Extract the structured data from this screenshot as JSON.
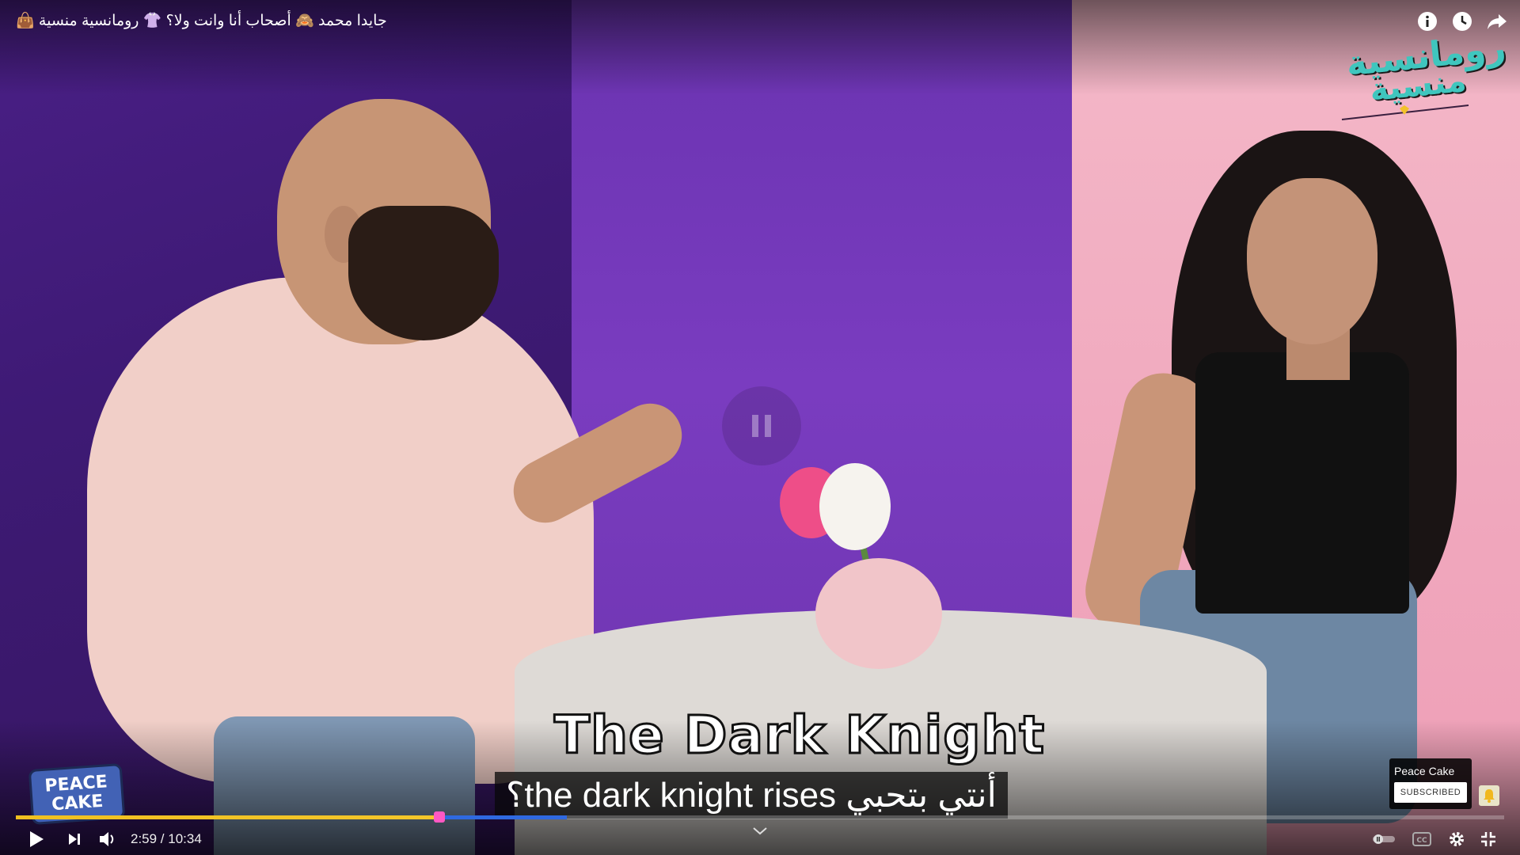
{
  "video": {
    "title": "جايدا محمد 🙈 أصحاب أنا وانت ولا؟ 👚 رومانسية منسية 👜",
    "show_logo_line1": "رومانسية",
    "show_logo_line2": "منسية"
  },
  "captions": {
    "main": "The Dark Knight",
    "subtitle": "أنتي بتحبي the dark knight rises؟"
  },
  "branding": {
    "watermark_line1": "PEACE",
    "watermark_line2": "CAKE"
  },
  "subscribe_card": {
    "channel_name": "Peace Cake",
    "button_label": "SUBSCRIBED"
  },
  "player": {
    "time_display": "2:59 / 10:34",
    "played_fraction": 0.283,
    "buffered_fraction": 0.37,
    "icons": {
      "info": "info-icon",
      "watch_later": "clock-icon",
      "share": "share-icon",
      "play": "play-icon",
      "next": "next-icon",
      "volume": "volume-icon",
      "autoplay": "autoplay-toggle-icon",
      "captions": "captions-icon",
      "settings": "gear-icon",
      "exit_fullscreen": "exit-fullscreen-icon",
      "chevron": "chevron-down-icon",
      "bell": "bell-icon",
      "pause_indicator": "pause-icon"
    },
    "colors": {
      "progress_played": "#f0c020",
      "scrubber": "#ff58c3"
    }
  }
}
